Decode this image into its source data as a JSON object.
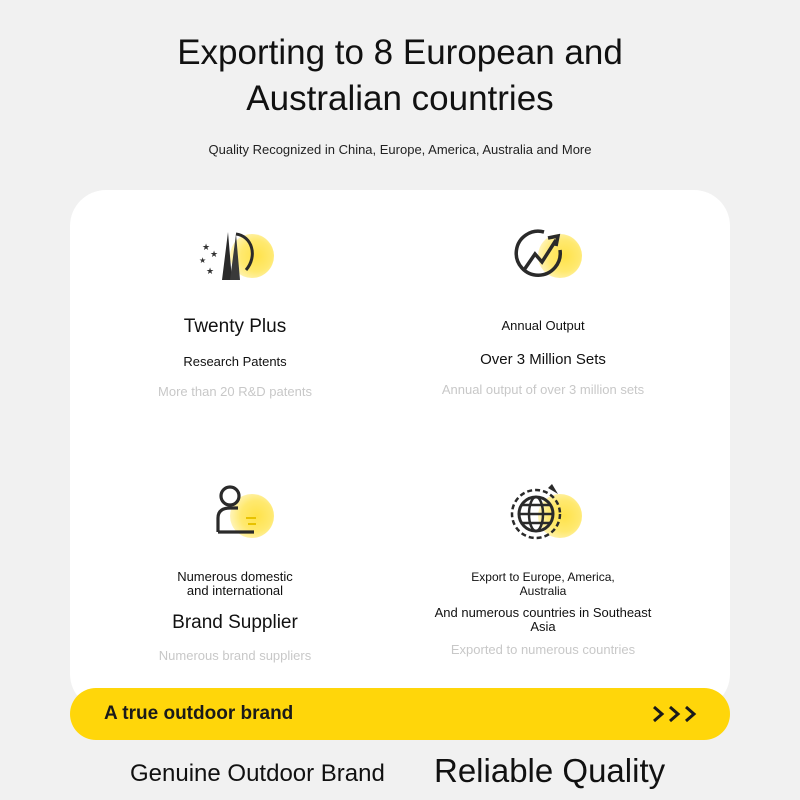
{
  "header": {
    "title_line1": "Exporting to 8 European and",
    "title_line2": "Australian countries",
    "subtitle": "Quality Recognized in China, Europe, America, Australia and More"
  },
  "features": [
    {
      "icon": "patent-rocket-icon",
      "line1": "Twenty Plus",
      "line2": "Research Patents",
      "desc": "More than 20 R&D patents"
    },
    {
      "icon": "growth-chart-icon",
      "line1": "Annual Output",
      "line2": "Over 3 Million Sets",
      "desc": "Annual output of over 3 million sets"
    },
    {
      "icon": "user-badge-icon",
      "line1": "Numerous domestic and international",
      "line2": "Brand Supplier",
      "desc": "Numerous brand suppliers"
    },
    {
      "icon": "globe-icon",
      "line1": "Export to Europe, America, Australia",
      "line2": "And numerous countries in Southeast Asia",
      "desc": "Exported to numerous countries"
    }
  ],
  "banner": {
    "text": "A true outdoor brand",
    "arrows": ">>>"
  },
  "footer": {
    "left": "Genuine Outdoor Brand",
    "right": "Reliable Quality"
  },
  "colors": {
    "accent": "#ffd60a",
    "background": "#f1f1f1",
    "card": "#ffffff",
    "muted_text": "#c8c8c8"
  }
}
